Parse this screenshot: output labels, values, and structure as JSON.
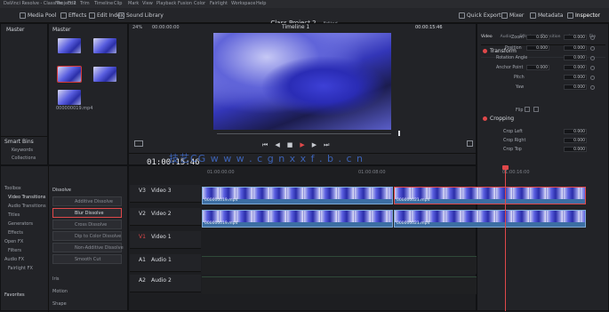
{
  "app": {
    "title": "DaVinci Resolve - Class Project 2",
    "project_title": "Class Project 2",
    "project_status": "Edited"
  },
  "menu": [
    "DaVinci Resolve",
    "File",
    "Edit",
    "Trim",
    "Timeline",
    "Clip",
    "Mark",
    "View",
    "Playback",
    "Fusion",
    "Color",
    "Fairlight",
    "Workspace",
    "Help"
  ],
  "toolbar": {
    "media_pool": "Media Pool",
    "effects": "Effects",
    "edit_index": "Edit Index",
    "sound_library": "Sound Library",
    "quick_export": "Quick Export",
    "mixer": "Mixer",
    "metadata": "Metadata",
    "inspector": "Inspector"
  },
  "viewer": {
    "zoom": "24%",
    "source_tc": "00:00:00:00",
    "timeline_name": "Timeline 1",
    "playhead_tc": "00:00:15:46"
  },
  "media_pool": {
    "left_header": "Master",
    "bin_header": "Master",
    "clips": [
      "",
      "",
      "",
      "000000019.mp4"
    ],
    "smart_bins_label": "Smart Bins",
    "smart_items": [
      "Keywords",
      "Collections"
    ]
  },
  "effects": {
    "tree": [
      "Toolbox",
      "Video Transitions",
      "Audio Transitions",
      "Titles",
      "Generators",
      "Effects",
      "Open FX",
      "Filters",
      "Audio FX",
      "Fairlight FX"
    ],
    "section": "Dissolve",
    "items": [
      "Additive Dissolve",
      "Blur Dissolve",
      "Cross Dissolve",
      "Dip to Color Dissolve",
      "Non-Additive Dissolve",
      "Smooth Cut"
    ],
    "section2": "Iris",
    "section3": "Motion",
    "section4": "Shape",
    "favorites": "Favorites"
  },
  "timeline": {
    "timecode": "01:00:15:46",
    "ruler": [
      "01:00:00:00",
      "01:00:08:00",
      "01:00:16:00"
    ],
    "tracks": [
      {
        "id": "V3",
        "name": "Video 3"
      },
      {
        "id": "V2",
        "name": "Video 2"
      },
      {
        "id": "V1",
        "name": "Video 1"
      },
      {
        "id": "A1",
        "name": "Audio 1"
      },
      {
        "id": "A2",
        "name": "Audio 2"
      }
    ],
    "clips": {
      "v3a": "000000019.mp4",
      "v3b": "000000021.mp4",
      "v2a": "000000019.mp4",
      "v2b": "000000021.mp4"
    }
  },
  "watermark": "技艺CG  w w w . c g n x x f . b . c n",
  "inspector": {
    "tabs": [
      "Video",
      "Audio",
      "Effects",
      "Transition",
      "Image",
      "File"
    ],
    "section1": "Transform",
    "rows": [
      {
        "label": "Zoom",
        "x": "0.000",
        "y": "0.000"
      },
      {
        "label": "Position",
        "x": "0.000",
        "y": "0.000"
      },
      {
        "label": "Rotation Angle",
        "x": "0.000",
        "y": ""
      },
      {
        "label": "Anchor Point",
        "x": "0.000",
        "y": "0.000"
      },
      {
        "label": "Pitch",
        "x": "0.000",
        "y": ""
      },
      {
        "label": "Yaw",
        "x": "0.000",
        "y": ""
      },
      {
        "label": "Flip",
        "x": "",
        "y": ""
      }
    ],
    "section2": "Cropping",
    "crop_rows": [
      {
        "label": "Crop Left",
        "v": "0.000"
      },
      {
        "label": "Crop Right",
        "v": "0.000"
      },
      {
        "label": "Crop Top",
        "v": "0.000"
      }
    ]
  },
  "colors": {
    "accent_red": "#e0484a",
    "clip_blue": "#3c6ea3",
    "panel": "#222327"
  }
}
